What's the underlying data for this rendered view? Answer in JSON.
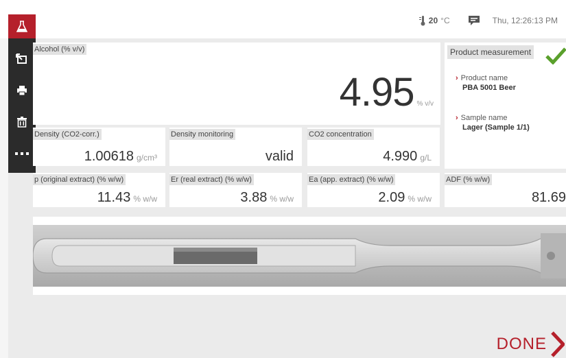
{
  "header": {
    "temperature_value": "20",
    "temperature_unit": "°C",
    "datetime": "Thu, 12:26:13 PM"
  },
  "icons": {
    "brand": "flask-icon",
    "thermometer": "thermometer-icon",
    "notes": "notes-icon",
    "rail": [
      "export-icon",
      "print-icon",
      "trash-icon",
      "more-icon"
    ]
  },
  "alcohol": {
    "label": "Alcohol (% v/v)",
    "value": "4.95",
    "unit": "% v/v"
  },
  "product": {
    "label": "Product measurement",
    "product_name_label": "Product name",
    "product_name_value": "PBA 5001 Beer",
    "sample_name_label": "Sample name",
    "sample_name_value": "Lager (Sample 1/1)"
  },
  "density": {
    "label": "Density (CO2-corr.)",
    "value": "1.00618",
    "unit": "g/cm³"
  },
  "density_monitoring": {
    "label": "Density monitoring",
    "value": "valid"
  },
  "co2": {
    "label": "CO2 concentration",
    "value": "4.990",
    "unit": "g/L"
  },
  "p_extract": {
    "label": "p (original extract) (% w/w)",
    "value": "11.43",
    "unit": "% w/w"
  },
  "er_extract": {
    "label": "Er (real extract) (% w/w)",
    "value": "3.88",
    "unit": "% w/w"
  },
  "ea_extract": {
    "label": "Ea (app. extract) (% w/w)",
    "value": "2.09",
    "unit": "% w/w"
  },
  "adf": {
    "label": "ADF (% w/w)",
    "value": "81.69"
  },
  "footer": {
    "done_label": "DONE"
  },
  "colors": {
    "accent": "#b5202b",
    "rail": "#2b2b2b",
    "check": "#5aa02c"
  }
}
